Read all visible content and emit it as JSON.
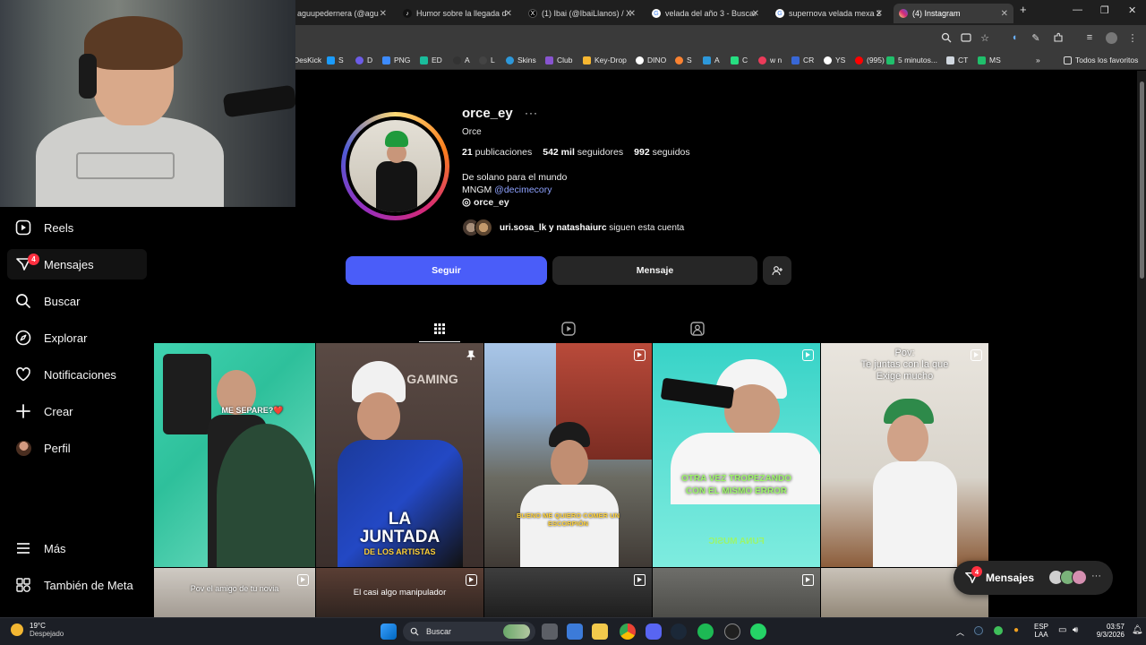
{
  "browser": {
    "tabs": [
      {
        "title": "aguupedernera (@agu",
        "icon": "instagram-favicon",
        "color": "#e4405f"
      },
      {
        "title": "Humor sobre la llegada d",
        "icon": "tiktok-favicon",
        "color": "#000000"
      },
      {
        "title": "(1) Ibai (@IbaiLlanos) / X",
        "icon": "x-favicon",
        "color": "#000000"
      },
      {
        "title": "velada del año 3 - Buscar",
        "icon": "google-favicon",
        "color": "#4285f4"
      },
      {
        "title": "supernova velada mexa 2",
        "icon": "google-favicon",
        "color": "#4285f4"
      },
      {
        "title": "(4) Instagram",
        "icon": "instagram-favicon",
        "color": "#e4405f"
      }
    ],
    "new_tab": "+",
    "bookmarks": [
      {
        "label": "DesKick",
        "color": "#53fc18"
      },
      {
        "label": "S",
        "color": "#1b9cfc"
      },
      {
        "label": "D",
        "color": "#6c5ce7"
      },
      {
        "label": "PNG",
        "color": "#3d8bfd"
      },
      {
        "label": "ED",
        "color": "#1abc9c"
      },
      {
        "label": "A",
        "color": "#333333"
      },
      {
        "label": "L",
        "color": "#444444"
      },
      {
        "label": "Skins",
        "color": "#2d98da"
      },
      {
        "label": "Club",
        "color": "#8854d0"
      },
      {
        "label": "Key-Drop",
        "color": "#f7b731"
      },
      {
        "label": "DINO",
        "color": "#ffffff"
      },
      {
        "label": "S",
        "color": "#fa8231"
      },
      {
        "label": "A",
        "color": "#2d98da"
      },
      {
        "label": "C",
        "color": "#26de81"
      },
      {
        "label": "w n",
        "color": "#eb3b5a"
      },
      {
        "label": "CR",
        "color": "#3867d6"
      },
      {
        "label": "YS",
        "color": "#ffffff"
      },
      {
        "label": "(995)",
        "color": "#ff0000"
      },
      {
        "label": "5 minutos...",
        "color": "#20bf6b"
      },
      {
        "label": "CT",
        "color": "#d1d8e0"
      },
      {
        "label": "MS",
        "color": "#20bf6b"
      }
    ],
    "all_favorites": "Todos los favoritos"
  },
  "sidebar": {
    "items": [
      {
        "label": "Reels",
        "icon": "reels-icon"
      },
      {
        "label": "Mensajes",
        "icon": "messenger-icon",
        "badge": "4"
      },
      {
        "label": "Buscar",
        "icon": "search-icon"
      },
      {
        "label": "Explorar",
        "icon": "compass-icon"
      },
      {
        "label": "Notificaciones",
        "icon": "heart-icon"
      },
      {
        "label": "Crear",
        "icon": "plus-icon"
      },
      {
        "label": "Perfil",
        "icon": "avatar"
      }
    ],
    "bottom": [
      {
        "label": "Más",
        "icon": "menu-icon"
      },
      {
        "label": "También de Meta",
        "icon": "meta-grid-icon"
      }
    ]
  },
  "profile": {
    "username": "orce_ey",
    "fullname": "Orce",
    "posts_count": "21",
    "posts_label": "publicaciones",
    "followers_count": "542 mil",
    "followers_label": "seguidores",
    "following_count": "992",
    "following_label": "seguidos",
    "bio_line1": "De solano para el mundo",
    "bio_line2_prefix": "MNGM",
    "bio_mention": "@decimecory",
    "threads_handle": "orce_ey",
    "followed_by_names": "uri.sosa_lk y natashaiurc",
    "followed_by_suffix": "siguen esta cuenta",
    "follow_label": "Seguir",
    "message_label": "Mensaje"
  },
  "grid": {
    "captions": [
      "ME SEPARE?❤️",
      "LA",
      "JUNTADA",
      "DE LOS ARTISTAS",
      "BUENO ME QUIERO COMER UN ESCORPIÓN",
      "OTRA VEZ TROPEZANDO",
      "CON EL MISMO ERROR",
      "FUNA MUSIC",
      "Pov:",
      "Te juntas con la que",
      "Exige mucho",
      "Pov el amigo de tu novia",
      "El casi algo manipulador",
      "GAMING"
    ]
  },
  "floating_messages": {
    "label": "Mensajes",
    "badge": "4"
  },
  "taskbar": {
    "temp": "19°C",
    "weather": "Despejado",
    "search": "Buscar",
    "lang1": "ESP",
    "lang2": "LAA",
    "time": "03:57",
    "date": "9/3/2026"
  }
}
